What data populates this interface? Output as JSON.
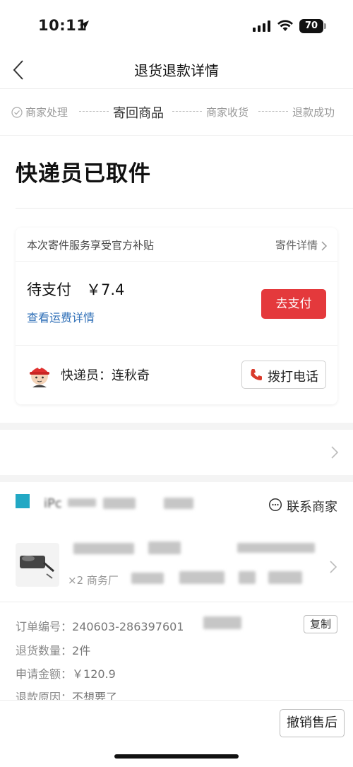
{
  "status_bar": {
    "time": "10:11",
    "battery": "70"
  },
  "nav": {
    "title": "退货退款详情"
  },
  "steps": [
    {
      "label": "商家处理",
      "state": "done"
    },
    {
      "label": "寄回商品",
      "state": "active"
    },
    {
      "label": "商家收货",
      "state": "pending"
    },
    {
      "label": "退款成功",
      "state": "pending"
    }
  ],
  "headline": "快递员已取件",
  "card": {
    "subsidy_text": "本次寄件服务享受官方补贴",
    "shipping_detail_link": "寄件详情",
    "pay_label": "待支付",
    "pay_amount": "￥7.4",
    "fee_detail_link": "查看运费详情",
    "pay_button": "去支付",
    "courier_text": "快递员：连秋奇",
    "call_button": "拨打电话"
  },
  "store": {
    "name_visible": "iPc",
    "contact_button": "联系商家"
  },
  "product": {
    "qty_text": "×2 商务厂"
  },
  "order_info": {
    "order_no_label": "订单编号：",
    "order_no_value": "240603-286397601",
    "copy_button": "复制",
    "return_qty_label": "退货数量：",
    "return_qty_value": "2件",
    "amount_label": "申请金额：",
    "amount_value": "￥120.9",
    "reason_label": "退款原因：",
    "reason_value": "不想要了"
  },
  "bottom": {
    "cancel_button": "撤销售后"
  },
  "colors": {
    "accent_red": "#e4393c",
    "link_blue": "#2f6fb7",
    "store_icon": "#22a8c4"
  }
}
